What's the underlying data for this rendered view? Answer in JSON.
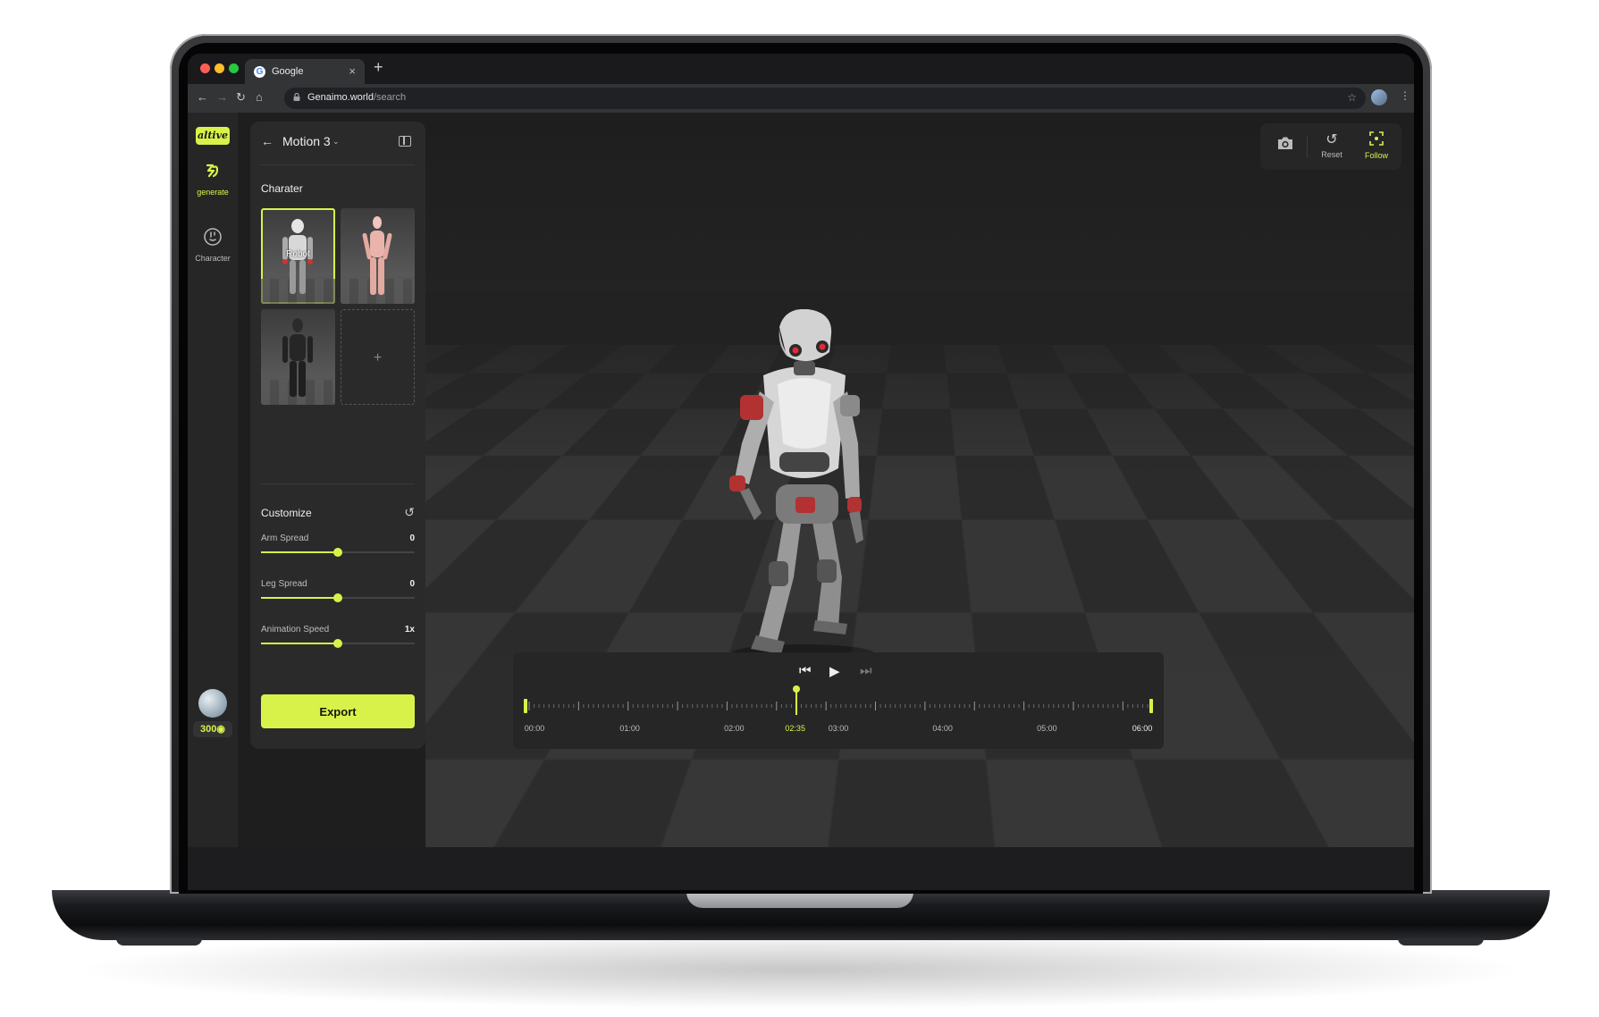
{
  "browser": {
    "tab_title": "Google",
    "tab_favicon": "G",
    "tab_close": "×",
    "new_tab": "+",
    "url_domain": "Genaimo.world",
    "url_path": "/search"
  },
  "app": {
    "logo": "altive",
    "rail": [
      {
        "label": "generate",
        "icon": "wave-icon",
        "active": true
      },
      {
        "label": "Character",
        "icon": "face-icon",
        "active": false
      }
    ],
    "credits": "300"
  },
  "panel": {
    "title": "Motion 3",
    "character_section": "Charater",
    "characters": [
      {
        "label": "Robot",
        "selected": true,
        "style": "robot"
      },
      {
        "label": "",
        "selected": false,
        "style": "mannequin-pink"
      },
      {
        "label": "",
        "selected": false,
        "style": "mannequin-dark"
      }
    ],
    "add_label": "+",
    "customize_title": "Customize",
    "sliders": [
      {
        "name": "Arm Spread",
        "value": "0",
        "level": 0.5
      },
      {
        "name": "Leg Spread",
        "value": "0",
        "level": 0.5
      },
      {
        "name": "Animation Speed",
        "value": "1x",
        "level": 0.5
      }
    ],
    "export_label": "Export"
  },
  "viewport": {
    "camera_tools": [
      {
        "label": "",
        "icon": "camera-icon"
      },
      {
        "label": "Reset",
        "icon": "reset-icon"
      },
      {
        "label": "Follow",
        "icon": "follow-icon",
        "active": true
      }
    ]
  },
  "timeline": {
    "labels": [
      "00:00",
      "01:00",
      "02:00",
      "03:00",
      "04:00",
      "05:00",
      "06:00"
    ],
    "current": "02:35",
    "current_fraction": 0.431,
    "total_seconds": 360
  },
  "colors": {
    "accent": "#d9f24a",
    "panel": "#2a2a2a",
    "background": "#1e1e1e"
  }
}
